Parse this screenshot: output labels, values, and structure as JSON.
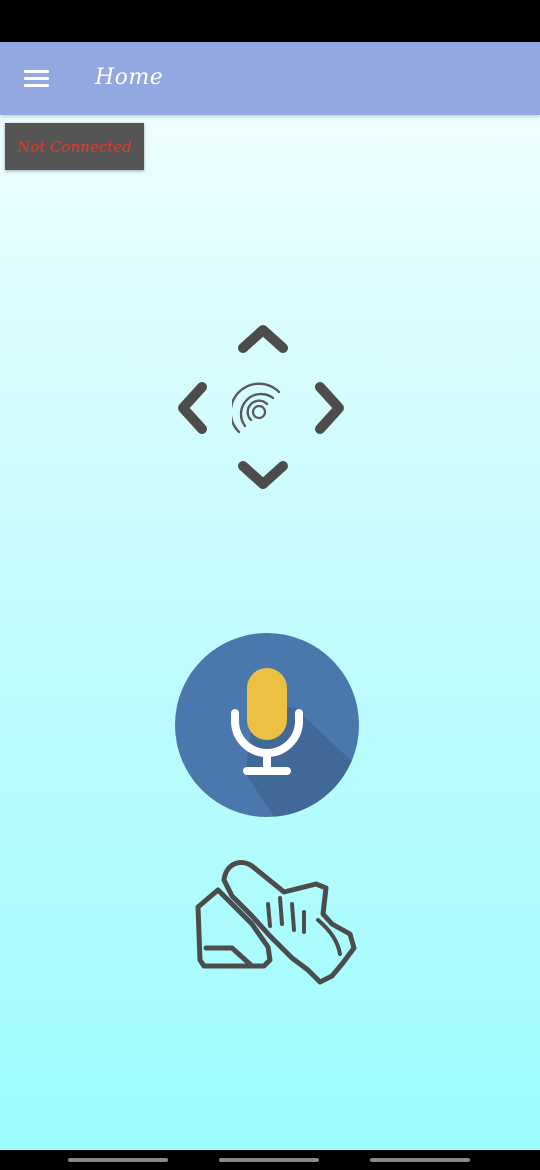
{
  "app_bar": {
    "title": "Home"
  },
  "connection": {
    "status": "Not Connected",
    "status_color": "#e63a2b"
  },
  "theme": {
    "app_bar_color": "#93a8e0",
    "mic_circle_color": "#4a78ad",
    "mic_capsule_color": "#ecc040",
    "icon_color": "#4c4c4c"
  },
  "icons": {
    "menu": "hamburger-menu-icon",
    "center": "wireless-signal-icon",
    "mic": "microphone-icon",
    "gesture": "swipe-hand-gesture-icon"
  }
}
